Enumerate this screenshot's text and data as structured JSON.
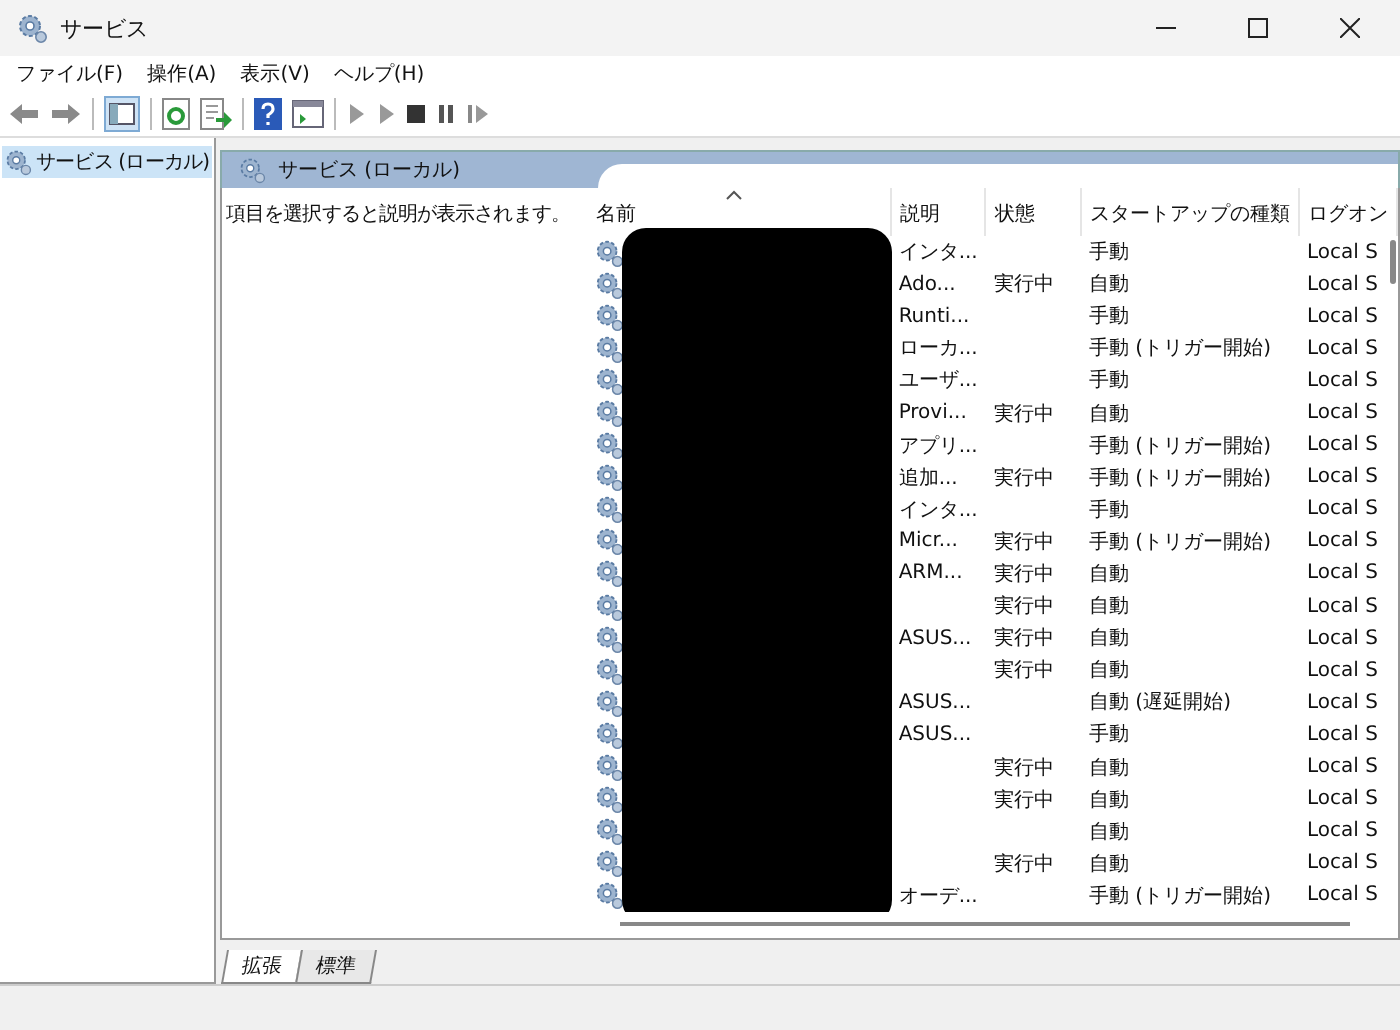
{
  "window": {
    "title": "サービス"
  },
  "menu": [
    "ファイル(F)",
    "操作(A)",
    "表示(V)",
    "ヘルプ(H)"
  ],
  "tree": {
    "items": [
      {
        "label": "サービス (ローカル)",
        "selected": true
      }
    ]
  },
  "panel": {
    "title": "サービス (ローカル)",
    "description": "項目を選択すると説明が表示されます。"
  },
  "table": {
    "columns": [
      {
        "label": "名前",
        "sorted": true
      },
      {
        "label": "説明",
        "sorted": false
      },
      {
        "label": "状態",
        "sorted": false
      },
      {
        "label": "スタートアップの種類",
        "sorted": false
      },
      {
        "label": "ログオン",
        "sorted": false
      }
    ],
    "rows": [
      {
        "description": "インタ...",
        "startup": "手動",
        "logon": "Local S"
      },
      {
        "description": "Ado...",
        "status": "実行中",
        "startup": "自動",
        "logon": "Local S"
      },
      {
        "description": "Runti...",
        "startup": "手動",
        "logon": "Local S"
      },
      {
        "description": "ローカ...",
        "startup": "手動 (トリガー開始)",
        "logon": "Local S"
      },
      {
        "description": "ユーザ...",
        "startup": "手動",
        "logon": "Local S"
      },
      {
        "description": "Provi...",
        "status": "実行中",
        "startup": "自動",
        "logon": "Local S"
      },
      {
        "description": "アプリ...",
        "startup": "手動 (トリガー開始)",
        "logon": "Local S"
      },
      {
        "description": "追加...",
        "status": "実行中",
        "startup": "手動 (トリガー開始)",
        "logon": "Local S"
      },
      {
        "description": "インタ...",
        "startup": "手動",
        "logon": "Local S"
      },
      {
        "description": "Micr...",
        "status": "実行中",
        "startup": "手動 (トリガー開始)",
        "logon": "Local S"
      },
      {
        "description": "ARM...",
        "status": "実行中",
        "startup": "自動",
        "logon": "Local S"
      },
      {
        "status": "実行中",
        "startup": "自動",
        "logon": "Local S"
      },
      {
        "description": "ASUS...",
        "status": "実行中",
        "startup": "自動",
        "logon": "Local S"
      },
      {
        "status": "実行中",
        "startup": "自動",
        "logon": "Local S"
      },
      {
        "description": "ASUS...",
        "startup": "自動 (遅延開始)",
        "logon": "Local S"
      },
      {
        "description": "ASUS...",
        "startup": "手動",
        "logon": "Local S"
      },
      {
        "status": "実行中",
        "startup": "自動",
        "logon": "Local S"
      },
      {
        "status": "実行中",
        "startup": "自動",
        "logon": "Local S"
      },
      {
        "startup": "自動",
        "logon": "Local S"
      },
      {
        "status": "実行中",
        "startup": "自動",
        "logon": "Local S"
      },
      {
        "description": "オーデ...",
        "startup": "手動 (トリガー開始)",
        "logon": "Local S"
      }
    ]
  },
  "tabs": [
    {
      "label": "拡張",
      "selected": true
    },
    {
      "label": "標準",
      "selected": false
    }
  ]
}
